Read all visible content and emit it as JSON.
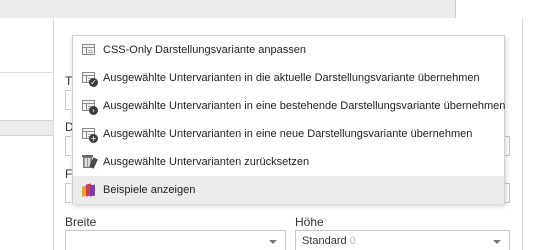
{
  "menu": {
    "items": [
      {
        "label": "CSS-Only Darstellungsvariante anpassen",
        "icon": "layout-icon"
      },
      {
        "label": "Ausgewählte Untervarianten in die aktuelle Darstellungsvariante übernehmen",
        "icon": "layout-check-icon"
      },
      {
        "label": "Ausgewählte Untervarianten in eine bestehende Darstellungsvariante übernehmen",
        "icon": "layout-arrow-icon"
      },
      {
        "label": "Ausgewählte Untervarianten in eine neue Darstellungsvariante übernehmen",
        "icon": "layout-plus-icon"
      },
      {
        "label": "Ausgewählte Untervarianten zurücksetzen",
        "icon": "reset-brush-icon"
      },
      {
        "label": "Beispiele anzeigen",
        "icon": "examples-book-icon"
      }
    ]
  },
  "background": {
    "partial_labels": [
      "T",
      "D",
      "F"
    ]
  },
  "form": {
    "width_label": "Breite",
    "width_value": "",
    "height_label": "Höhe",
    "height_value": "Standard",
    "height_value_suffix": "0"
  }
}
